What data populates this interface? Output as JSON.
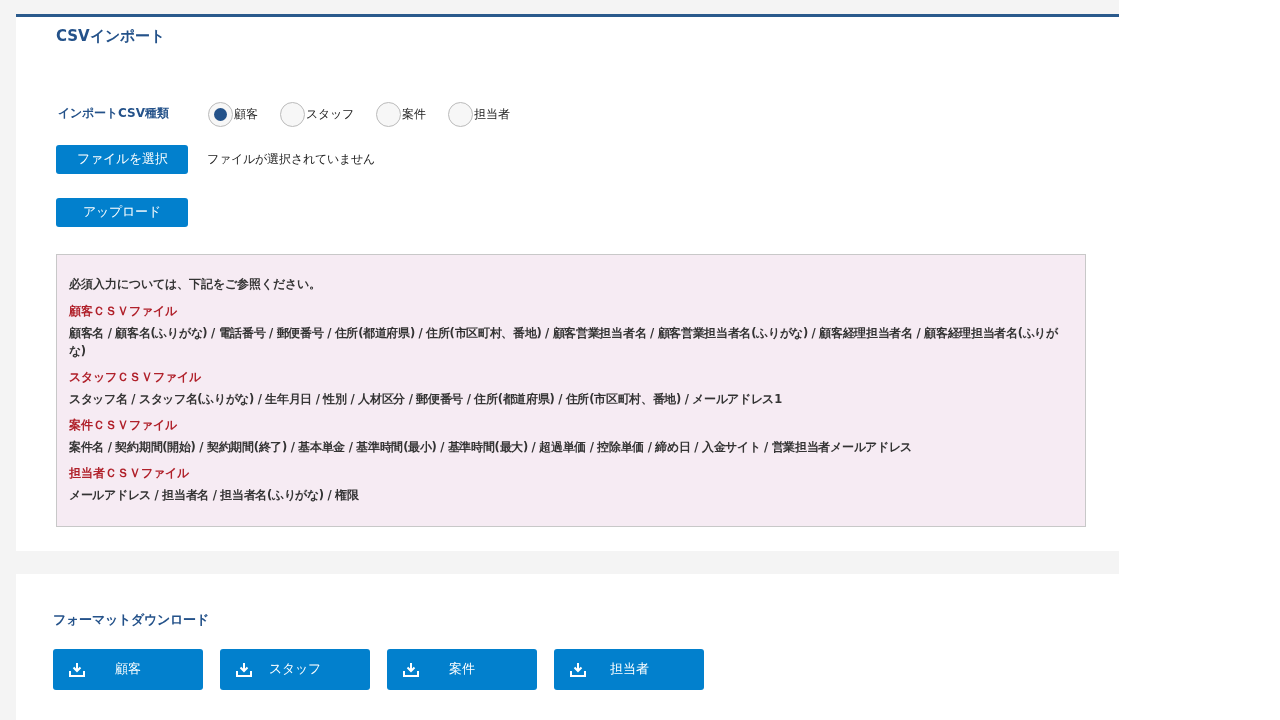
{
  "import": {
    "title": "CSVインポート",
    "type_label": "インポートCSV種類",
    "types": [
      {
        "label": "顧客",
        "selected": true
      },
      {
        "label": "スタッフ",
        "selected": false
      },
      {
        "label": "案件",
        "selected": false
      },
      {
        "label": "担当者",
        "selected": false
      }
    ],
    "file_button": "ファイルを選択",
    "file_status": "ファイルが選択されていません",
    "upload_button": "アップロード",
    "notes": {
      "intro": "必須入力については、下記をご参照ください。",
      "sections": [
        {
          "heading": "顧客ＣＳＶファイル",
          "fields": "顧客名 / 顧客名(ふりがな) / 電話番号 / 郵便番号 / 住所(都道府県) / 住所(市区町村、番地) / 顧客営業担当者名 / 顧客営業担当者名(ふりがな) / 顧客経理担当者名 / 顧客経理担当者名(ふりがな)"
        },
        {
          "heading": "スタッフＣＳＶファイル",
          "fields": "スタッフ名 / スタッフ名(ふりがな) / 生年月日 / 性別 / 人材区分 / 郵便番号 / 住所(都道府県) / 住所(市区町村、番地) / メールアドレス1"
        },
        {
          "heading": "案件ＣＳＶファイル",
          "fields": "案件名 / 契約期間(開始) / 契約期間(終了) / 基本単金 / 基準時間(最小) / 基準時間(最大) / 超過単価 / 控除単価 / 締め日 / 入金サイト / 営業担当者メールアドレス"
        },
        {
          "heading": "担当者ＣＳＶファイル",
          "fields": "メールアドレス / 担当者名 / 担当者名(ふりがな) / 権限"
        }
      ]
    }
  },
  "download": {
    "title": "フォーマットダウンロード",
    "buttons": [
      "顧客",
      "スタッフ",
      "案件",
      "担当者"
    ]
  }
}
